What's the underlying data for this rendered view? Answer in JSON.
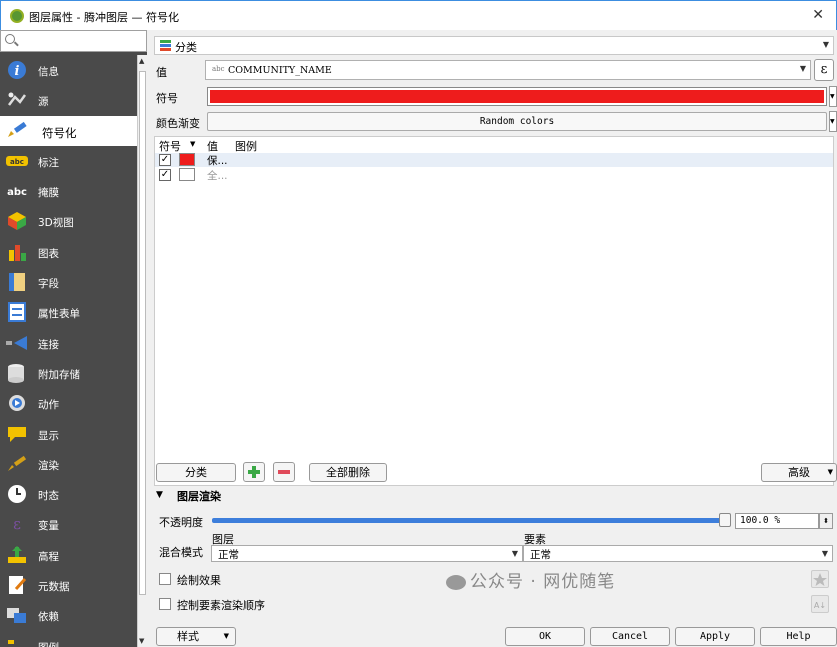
{
  "window": {
    "title": "图层属性 - 腾冲图层 — 符号化"
  },
  "sidebar": {
    "items": [
      {
        "label": "信息",
        "icon": "info-icon"
      },
      {
        "label": "源",
        "icon": "source-icon"
      },
      {
        "label": "符号化",
        "icon": "paintbrush-icon",
        "active": true
      },
      {
        "label": "标注",
        "icon": "labels-icon"
      },
      {
        "label": "掩膜",
        "icon": "mask-icon"
      },
      {
        "label": "3D视图",
        "icon": "cube-icon"
      },
      {
        "label": "图表",
        "icon": "diagram-icon"
      },
      {
        "label": "字段",
        "icon": "fields-icon"
      },
      {
        "label": "属性表单",
        "icon": "form-icon"
      },
      {
        "label": "连接",
        "icon": "join-icon"
      },
      {
        "label": "附加存储",
        "icon": "storage-icon"
      },
      {
        "label": "动作",
        "icon": "action-icon"
      },
      {
        "label": "显示",
        "icon": "display-icon"
      },
      {
        "label": "渲染",
        "icon": "rendering-icon"
      },
      {
        "label": "时态",
        "icon": "clock-icon"
      },
      {
        "label": "变量",
        "icon": "variables-icon"
      },
      {
        "label": "高程",
        "icon": "elevation-icon"
      },
      {
        "label": "元数据",
        "icon": "metadata-icon"
      },
      {
        "label": "依赖",
        "icon": "dependencies-icon"
      },
      {
        "label": "图例",
        "icon": "legend-icon"
      }
    ]
  },
  "main": {
    "renderer": "分类",
    "value_label": "值",
    "value_tag": "abc",
    "value_field": "COMMUNITY_NAME",
    "expr_symbol": "ε",
    "symbol_label": "符号",
    "ramp_label": "颜色渐变",
    "ramp_value": "Random colors",
    "table_headers": {
      "symbol": "符号",
      "value": "值",
      "legend": "图例"
    },
    "rows": [
      {
        "checked": "✓",
        "value": "保...",
        "color": "#ee1c1c"
      },
      {
        "checked": "✓",
        "value": "全...",
        "color": "#ffffff"
      }
    ],
    "classify_btn": "分类",
    "delete_all_btn": "全部删除",
    "advanced_btn": "高级",
    "layer_rendering": "图层渲染",
    "opacity_label": "不透明度",
    "opacity_value": "100.0 %",
    "opacity_fraction": 1.0,
    "blend_label": "混合模式",
    "blend_layer_label": "图层",
    "blend_layer_value": "正常",
    "blend_feature_label": "要素",
    "blend_feature_value": "正常",
    "draw_effects": "绘制效果",
    "control_order": "控制要素渲染顺序",
    "style_btn": "样式",
    "ok_btn": "OK",
    "cancel_btn": "Cancel",
    "apply_btn": "Apply",
    "help_btn": "Help"
  },
  "watermark": "公众号 · 网优随笔",
  "colors": {
    "symbol_fill": "#ee1c1c",
    "accent": "#3d7edb",
    "sidebar_bg": "#4a4a4a"
  }
}
